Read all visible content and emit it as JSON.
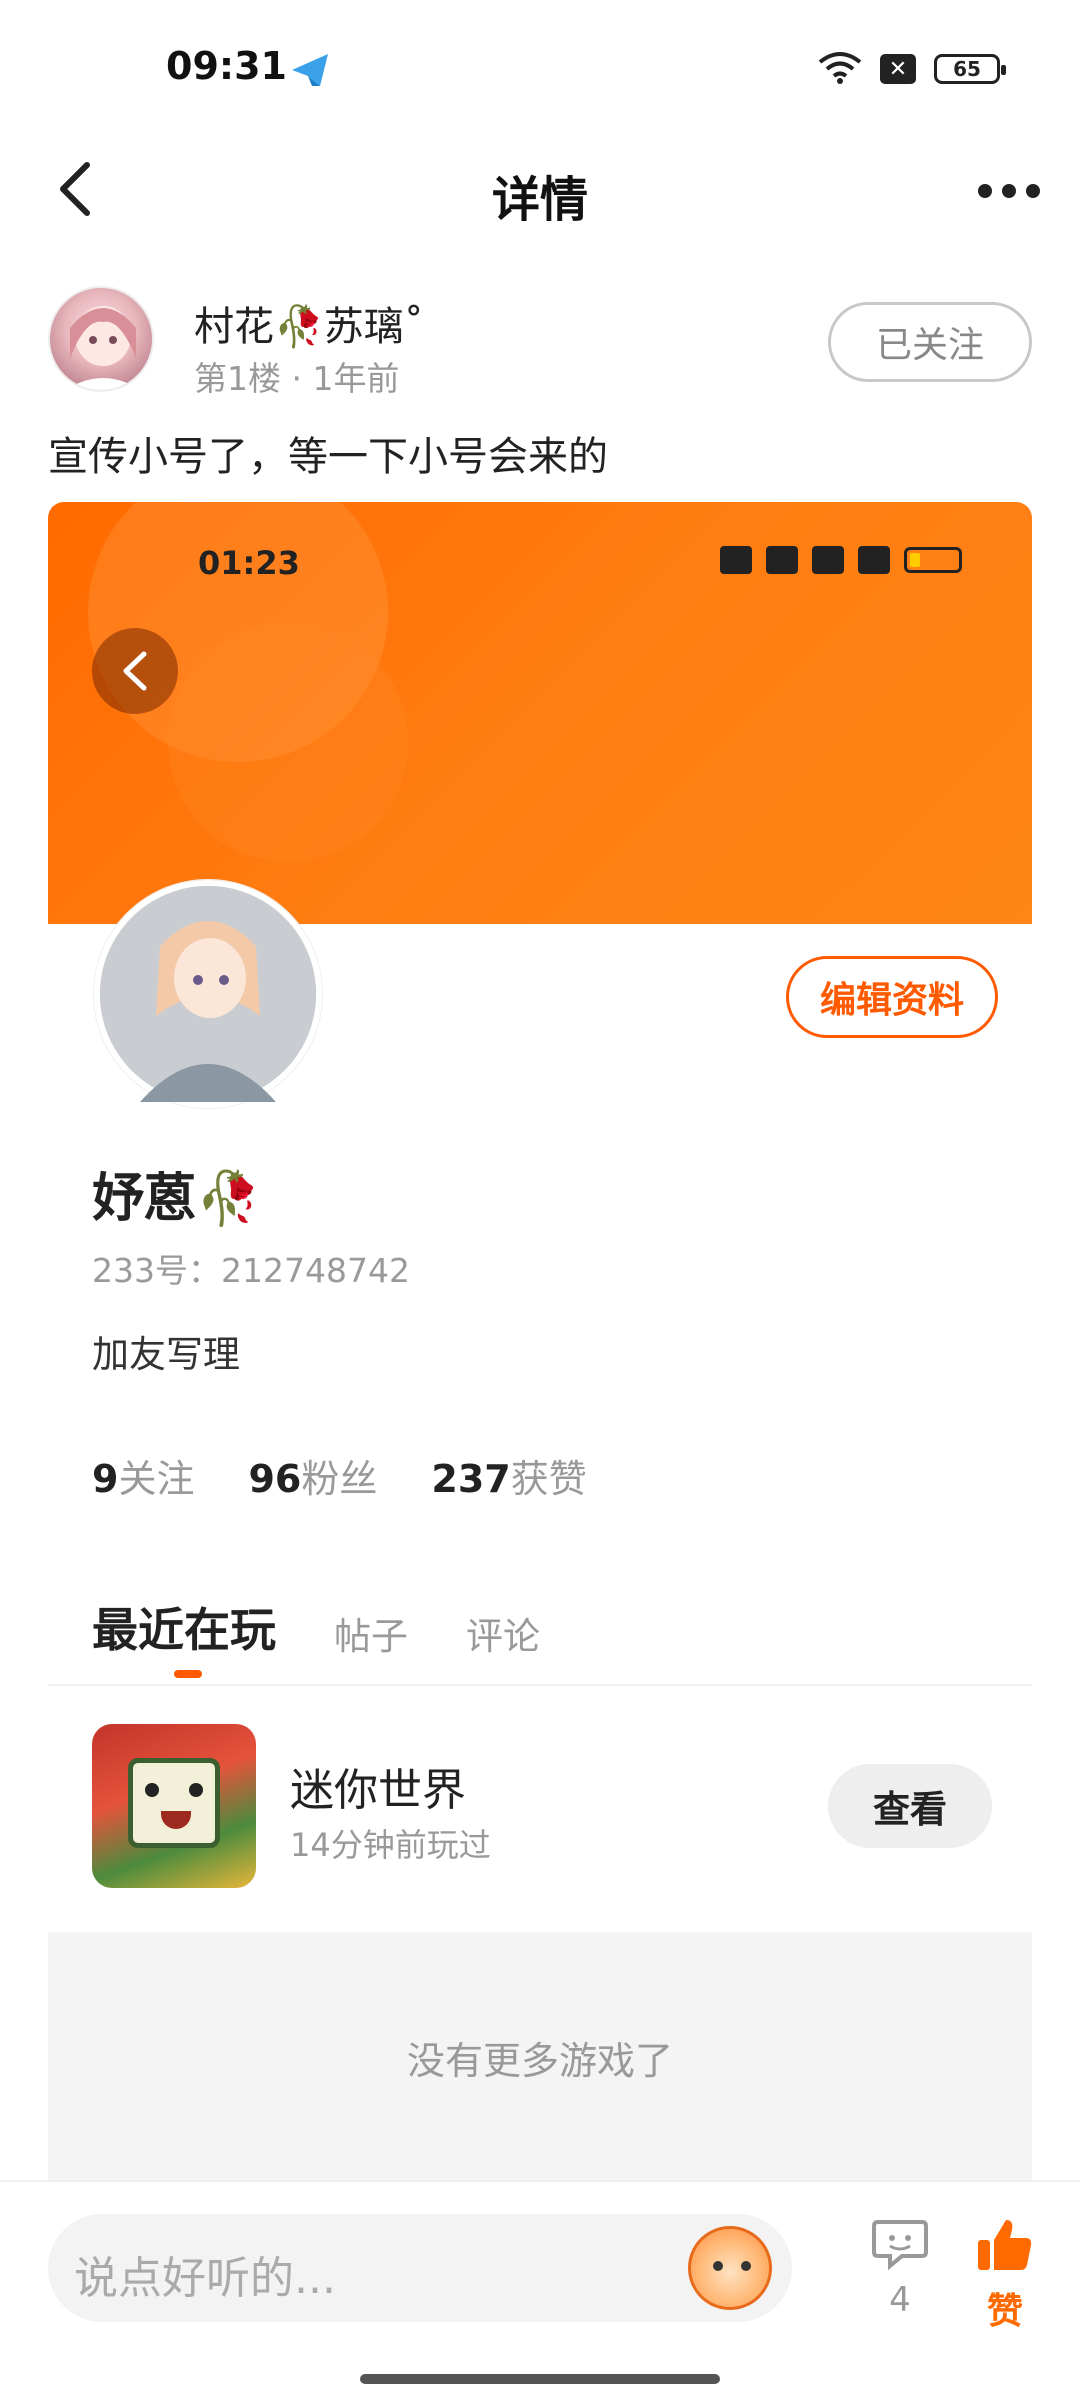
{
  "status_bar": {
    "time": "09:31",
    "battery": "65",
    "icons": [
      "telegram-icon",
      "wifi-icon",
      "sim-icon",
      "battery-icon"
    ]
  },
  "topbar": {
    "title": "详情",
    "back_icon": "chevron-left-icon",
    "more_icon": "more-dots-icon"
  },
  "post": {
    "author_name": "村花🥀苏璃˚",
    "meta": "第1楼 · 1年前",
    "follow_label": "已关注",
    "text": "宣传小号了，等一下小号会来的"
  },
  "screenshot": {
    "status_time": "01:23",
    "edit_label": "编辑资料",
    "profile_name": "妤蒽🥀",
    "profile_id": "233号：212748742",
    "bio": "加友写理",
    "stats": [
      {
        "num": "9",
        "label": "关注"
      },
      {
        "num": "96",
        "label": "粉丝"
      },
      {
        "num": "237",
        "label": "获赞"
      }
    ],
    "tabs": [
      "最近在玩",
      "帖子",
      "评论"
    ],
    "game": {
      "name": "迷你世界",
      "meta": "14分钟前玩过",
      "action": "查看"
    },
    "no_more": "没有更多游戏了"
  },
  "bottom": {
    "placeholder": "说点好听的...",
    "comment_count": "4",
    "like_label": "赞"
  },
  "colors": {
    "accent": "#ff6a00",
    "banner": "#ff7d12"
  }
}
